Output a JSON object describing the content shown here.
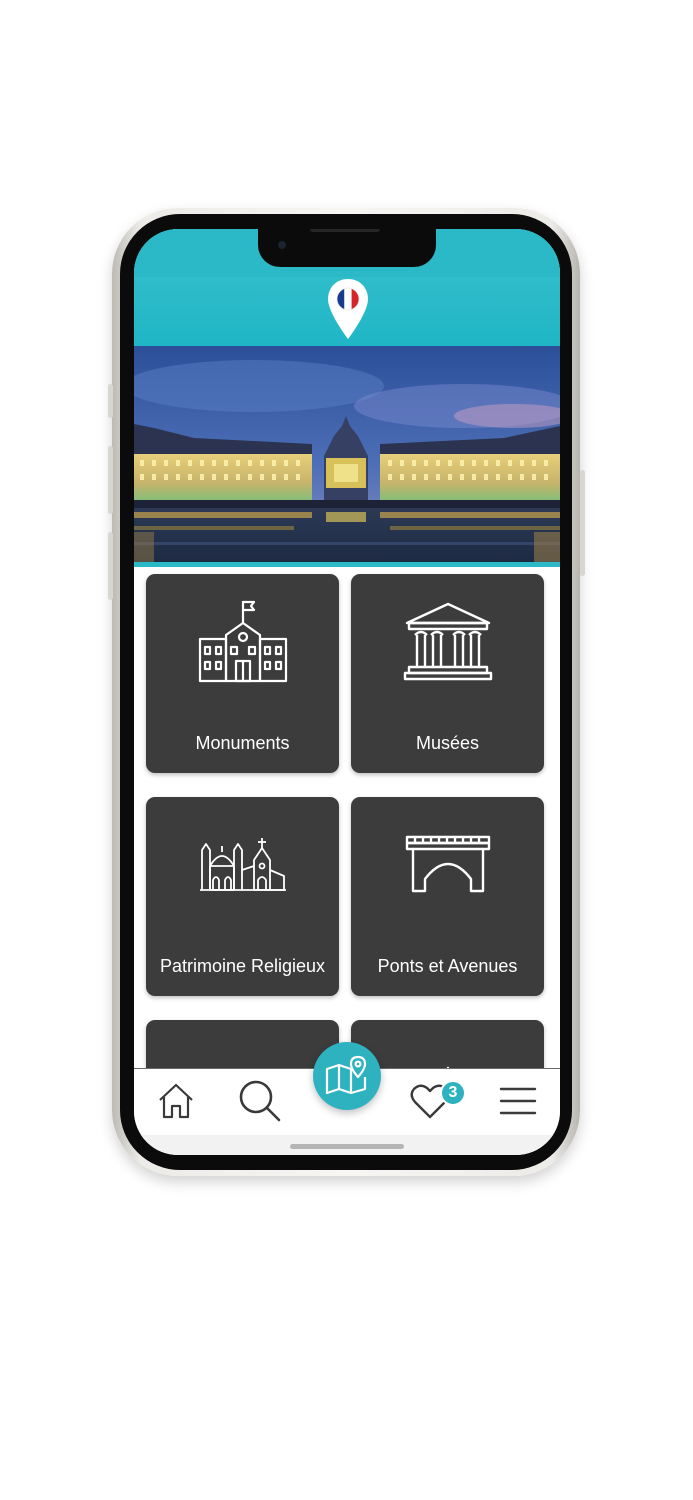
{
  "app": {
    "language_flag": "french-flag-icon",
    "hero_image": "Place de la Bourse at dusk with reflecting water"
  },
  "categories": [
    {
      "label": "Monuments",
      "icon": "monument-building-icon"
    },
    {
      "label": "Musées",
      "icon": "museum-icon"
    },
    {
      "label": "Patrimoine Religieux",
      "icon": "religious-heritage-icon"
    },
    {
      "label": "Ponts et Avenues",
      "icon": "bridge-icon"
    },
    {
      "label": "",
      "icon": "nature-park-icon"
    },
    {
      "label": "",
      "icon": "sunrise-icon"
    }
  ],
  "nav": {
    "home_icon": "home-icon",
    "search_icon": "search-icon",
    "map_icon": "map-icon",
    "favorites_icon": "heart-icon",
    "favorites_count": "3",
    "menu_icon": "menu-icon"
  },
  "colors": {
    "accent": "#2eb2bf",
    "tile": "#3c3c3c",
    "header": "#1fb6c6"
  }
}
